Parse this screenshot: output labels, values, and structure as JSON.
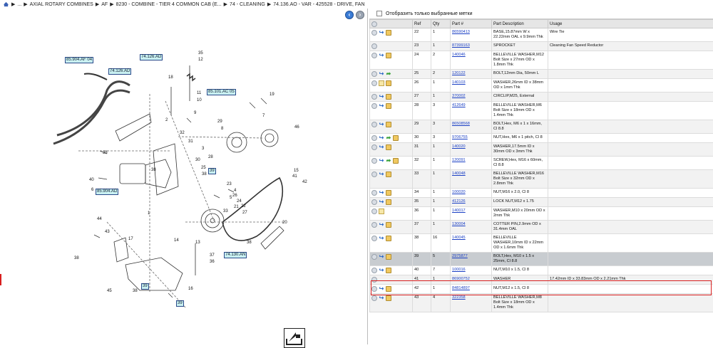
{
  "breadcrumb": [
    "...",
    "AXIAL ROTARY COMBINES",
    "AF",
    "8230 - COMBINE - TIER 4 COMMON CAB (E...",
    "74 - CLEANING",
    "74.136.AO - VAR - 425528 - DRIVE, FAN"
  ],
  "filter": {
    "label": "Отобразить только выбранные метки"
  },
  "table": {
    "headers": [
      "",
      "Ref",
      "Qty",
      "Part #",
      "Part Description",
      "Usage"
    ],
    "rows": [
      {
        "ref": "22",
        "qty": "1",
        "part": "86590413",
        "desc": "BASE,15.87mm W x 22.22mm OAL x 9.9mm Thk",
        "usage": "Wire Tie",
        "icons": [
          "circle",
          "arrow",
          "box"
        ]
      },
      {
        "ref": "23",
        "qty": "1",
        "part": "87399163",
        "desc": "SPROCKET",
        "usage": "Cleaning Fan Speed Reductor",
        "icons": [
          "circle"
        ]
      },
      {
        "ref": "24",
        "qty": "2",
        "part": "140046",
        "desc": "BELLEVILLE WASHER,M12 Bolt Size x 27mm OD x 1.8mm Thk",
        "usage": "",
        "icons": [
          "circle",
          "arrow",
          "box"
        ]
      },
      {
        "ref": "25",
        "qty": "2",
        "part": "120122",
        "desc": "BOLT,12mm Dia, 50mm L",
        "usage": "",
        "icons": [
          "circle",
          "arrow",
          "green"
        ]
      },
      {
        "ref": "26",
        "qty": "1",
        "part": "140103",
        "desc": "WASHER,26mm ID x 38mm OD x 1mm Thk",
        "usage": "",
        "icons": [
          "circle",
          "env",
          "box"
        ]
      },
      {
        "ref": "27",
        "qty": "1",
        "part": "370002",
        "desc": "CIRCLIP,M25, External",
        "usage": "",
        "icons": [
          "circle",
          "arrow",
          "box"
        ]
      },
      {
        "ref": "28",
        "qty": "3",
        "part": "412649",
        "desc": "BELLEVILLE WASHER,M6 Bolt Size x 18mm OD x 1.4mm Thk",
        "usage": "",
        "icons": [
          "circle",
          "arrow",
          "box"
        ]
      },
      {
        "ref": "29",
        "qty": "3",
        "part": "86508568",
        "desc": "BOLT,Hex, M6 x 1 x 16mm, Cl 8.8",
        "usage": "",
        "icons": [
          "circle",
          "arrow",
          "box"
        ]
      },
      {
        "ref": "30",
        "qty": "3",
        "part": "9706755",
        "desc": "NUT,Hex, M6 x 1 pitch, Cl 8",
        "usage": "",
        "icons": [
          "circle",
          "arrow",
          "green",
          "box"
        ]
      },
      {
        "ref": "31",
        "qty": "1",
        "part": "140020",
        "desc": "WASHER,17.5mm ID x 30mm OD x 3mm Thk",
        "usage": "",
        "icons": [
          "circle",
          "arrow",
          "box"
        ]
      },
      {
        "ref": "32",
        "qty": "1",
        "part": "120091",
        "desc": "SCREW,Hex, M16 x 60mm, Cl 8.8",
        "usage": "",
        "icons": [
          "circle",
          "arrow",
          "green",
          "box"
        ]
      },
      {
        "ref": "33",
        "qty": "1",
        "part": "140048",
        "desc": "BELLEVILLE WASHER,M16 Bolt Size x 32mm OD x 2.8mm Thk",
        "usage": "",
        "icons": [
          "circle",
          "arrow",
          "box"
        ]
      },
      {
        "ref": "34",
        "qty": "1",
        "part": "100020",
        "desc": "NUT,M16 x 2.0, Cl 8",
        "usage": "",
        "icons": [
          "circle",
          "arrow",
          "box"
        ]
      },
      {
        "ref": "35",
        "qty": "1",
        "part": "412126",
        "desc": "LOCK NUT,M12 x 1.75",
        "usage": "",
        "icons": [
          "circle",
          "arrow",
          "box"
        ]
      },
      {
        "ref": "36",
        "qty": "1",
        "part": "140017",
        "desc": "WASHER,M10 x 20mm OD x 2mm Thk",
        "usage": "",
        "icons": [
          "circle",
          "env"
        ]
      },
      {
        "ref": "37",
        "qty": "1",
        "part": "130004",
        "desc": "COTTER PIN,2.9mm OD x 31.4mm OAL",
        "usage": "",
        "icons": [
          "circle",
          "arrow",
          "box"
        ]
      },
      {
        "ref": "38",
        "qty": "16",
        "part": "140045",
        "desc": "BELLEVILLE WASHER,10mm ID x 22mm OD x 1.6mm Thk",
        "usage": "",
        "icons": [
          "circle",
          "arrow",
          "box"
        ]
      },
      {
        "ref": "39",
        "qty": "5",
        "part": "2975877",
        "desc": "BOLT,Hex, M10 x 1.5 x 25mm, Cl 8.8",
        "usage": "",
        "icons": [
          "circle",
          "arrow",
          "box"
        ],
        "selected": true
      },
      {
        "ref": "40",
        "qty": "7",
        "part": "100016",
        "desc": "NUT,M10 x 1.5, Cl 8",
        "usage": "",
        "icons": [
          "circle",
          "arrow",
          "box"
        ]
      },
      {
        "ref": "41",
        "qty": "1",
        "part": "86900752",
        "desc": "WASHER",
        "usage": "17.42mm ID x 33.83mm OD x 2.21mm Thk",
        "icons": [
          "circle"
        ]
      },
      {
        "ref": "42",
        "qty": "1",
        "part": "84814897",
        "desc": "NUT,M12 x 1.5, Cl 8",
        "usage": "",
        "icons": [
          "circle",
          "arrow",
          "box"
        ]
      },
      {
        "ref": "43",
        "qty": "4",
        "part": "322358",
        "desc": "BELLEVILLE WASHER,M8 Bolt Size x 18mm OD x 1.4mm Thk",
        "usage": "",
        "icons": [
          "circle",
          "arrow",
          "box"
        ]
      }
    ]
  },
  "diagram": {
    "tags": [
      "85.904.AF 04",
      "74.126.AD",
      "74.126.AD",
      "85.101.AC 05",
      "85.904.AD",
      "74.130.AN"
    ],
    "callouts": [
      "35",
      "12",
      "18",
      "2",
      "11",
      "10",
      "9",
      "19",
      "29",
      "8",
      "46",
      "32",
      "31",
      "3",
      "28",
      "38",
      "20",
      "25",
      "38",
      "40",
      "6",
      "4",
      "44",
      "5",
      "14",
      "41",
      "42",
      "15",
      "43",
      "17",
      "13",
      "37",
      "36",
      "38",
      "45",
      "38",
      "16",
      "1",
      "7",
      "30",
      "23",
      "26",
      "24",
      "22",
      "33",
      "27",
      "21",
      "38",
      "38",
      "38"
    ],
    "hl_labels": [
      "39",
      "39",
      "39"
    ]
  }
}
